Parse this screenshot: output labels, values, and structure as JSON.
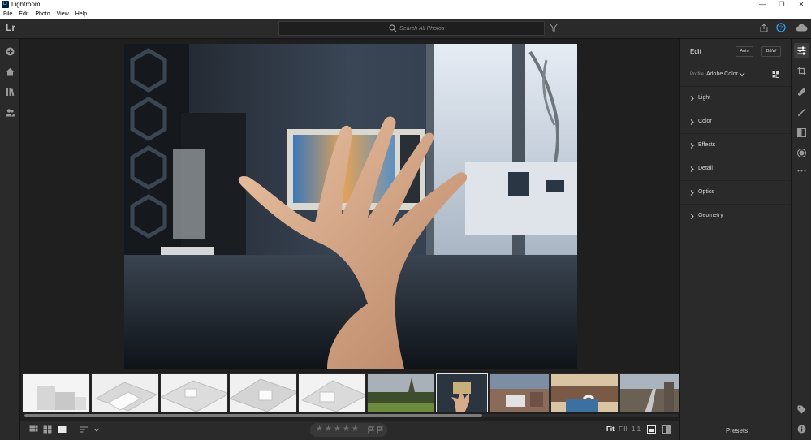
{
  "window": {
    "app_icon_letter": "Lr",
    "title": "Lightroom",
    "minimize": "—",
    "maximize": "❐",
    "close": "✕"
  },
  "menu": [
    "File",
    "Edit",
    "Photo",
    "View",
    "Help"
  ],
  "toolbar": {
    "logo": "Lr",
    "search_placeholder": "Search All Photos"
  },
  "left_rail": {
    "icons": [
      "add-photos-icon",
      "home-icon",
      "library-icon",
      "people-icon"
    ]
  },
  "edit_panel": {
    "title": "Edit",
    "auto_label": "Auto",
    "bw_label": "B&W",
    "profile_label": "Profile",
    "profile_value": "Adobe Color",
    "sections": [
      "Light",
      "Color",
      "Effects",
      "Detail",
      "Optics",
      "Geometry"
    ],
    "presets_label": "Presets"
  },
  "right_rail": {
    "icons": [
      "edit-sliders-icon",
      "crop-rotate-icon",
      "healing-brush-icon",
      "brush-icon",
      "linear-gradient-icon",
      "radial-gradient-icon",
      "more-icon",
      "tag-icon",
      "info-icon"
    ]
  },
  "filmstrip": {
    "thumbnail_count": 10,
    "selected_index": 6,
    "scroll_fraction": 0.7
  },
  "bottom_bar": {
    "stars": [
      "★",
      "★",
      "★",
      "★",
      "★"
    ],
    "zoom_fit": "Fit",
    "zoom_fill": "Fill",
    "zoom_1to1": "1:1"
  },
  "colors": {
    "panel_bg": "#2a2a2a",
    "app_bg": "#1f1f1f",
    "accent": "#31a8ff"
  }
}
